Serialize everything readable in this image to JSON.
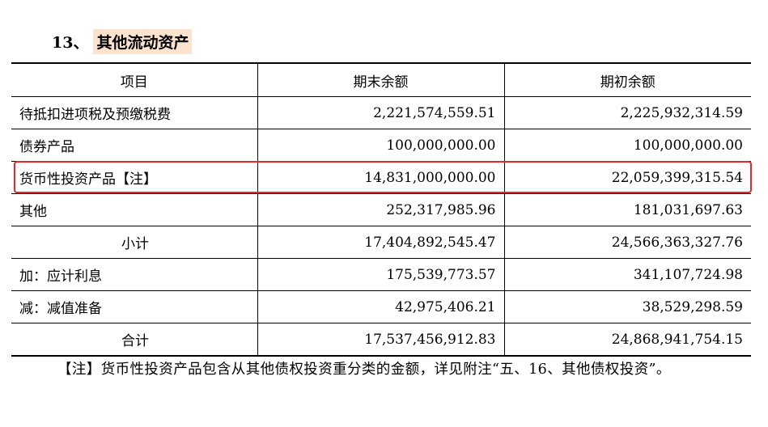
{
  "heading": {
    "number": "13、",
    "title": "其他流动资产"
  },
  "table": {
    "headers": [
      "项目",
      "期末余额",
      "期初余额"
    ],
    "rows": [
      {
        "item": "待抵扣进项税及预缴税费",
        "end": "2,221,574,559.51",
        "begin": "2,225,932,314.59"
      },
      {
        "item": "债券产品",
        "end": "100,000,000.00",
        "begin": "100,000,000.00"
      },
      {
        "item": "货币性投资产品【注】",
        "end": "14,831,000,000.00",
        "begin": "22,059,399,315.54"
      },
      {
        "item": "其他",
        "end": "252,317,985.96",
        "begin": "181,031,697.63"
      },
      {
        "item": "小计",
        "end": "17,404,892,545.47",
        "begin": "24,566,363,327.76"
      },
      {
        "item": "加：应计利息",
        "end": "175,539,773.57",
        "begin": "341,107,724.98"
      },
      {
        "item": "减：减值准备",
        "end": "42,975,406.21",
        "begin": "38,529,298.59"
      },
      {
        "item": "合计",
        "end": "17,537,456,912.83",
        "begin": "24,868,941,754.15"
      }
    ]
  },
  "note": "【注】货币性投资产品包含从其他债权投资重分类的金额，详见附注“五、16、其他债权投资”。",
  "colors": {
    "highlight_border": "#e8262b",
    "title_bg": "#fbe3cf"
  }
}
